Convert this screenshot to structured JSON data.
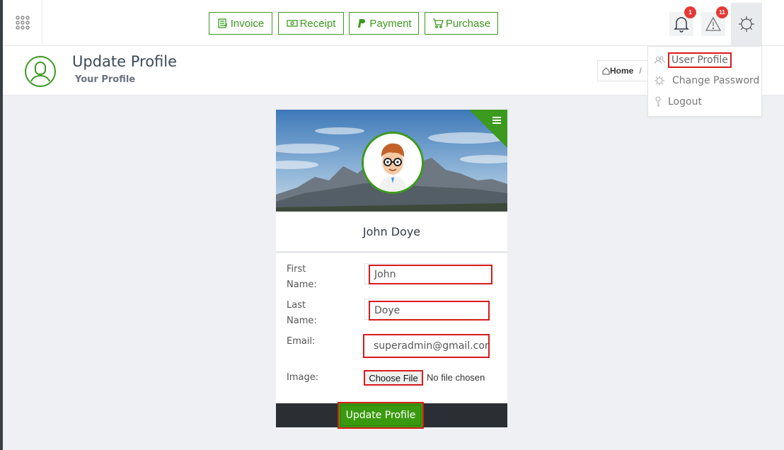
{
  "topbar": {
    "quick_actions": [
      {
        "label": "Invoice",
        "icon": "invoice-icon"
      },
      {
        "label": "Receipt",
        "icon": "money-icon"
      },
      {
        "label": "Payment",
        "icon": "paypal-icon"
      },
      {
        "label": "Purchase",
        "icon": "cart-icon"
      }
    ],
    "notifications_count": "1",
    "alerts_count": "11"
  },
  "page": {
    "title": "Update Profile",
    "subtitle": "Your Profile"
  },
  "breadcrumb": {
    "home": "Home",
    "separator": "/"
  },
  "settings_menu": {
    "items": [
      {
        "label": "User Profile",
        "icon": "users-icon"
      },
      {
        "label": "Change Password",
        "icon": "gear-icon"
      },
      {
        "label": "Logout",
        "icon": "key-icon"
      }
    ]
  },
  "profile": {
    "name": "John Doye",
    "form": {
      "first_name_label": "First Name:",
      "first_name_value": "John",
      "last_name_label": "Last Name:",
      "last_name_value": "Doye",
      "email_label": "Email:",
      "email_value": "superadmin@gmail.com",
      "image_label": "Image:",
      "choose_file_label": "Choose File",
      "no_file_text": "No file chosen",
      "submit_label": "Update Profile"
    }
  },
  "colors": {
    "accent": "#3c9a1e",
    "highlight_outline": "#d81b1b",
    "badge": "#e53935",
    "footer": "#2b2f33"
  }
}
